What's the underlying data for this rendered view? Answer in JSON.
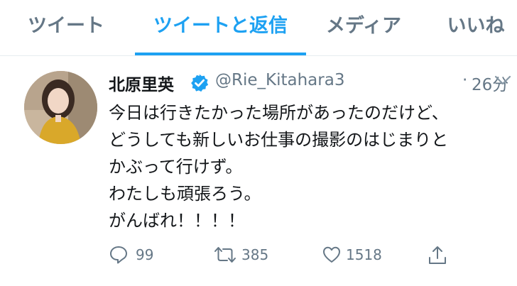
{
  "tabs": [
    {
      "label": "ツイート",
      "active": false
    },
    {
      "label": "ツイートと返信",
      "active": true
    },
    {
      "label": "メディア",
      "active": false
    },
    {
      "label": "いいね",
      "active": false
    }
  ],
  "tweet": {
    "author_name": "北原里英",
    "handle": "@Rie_Kitahara3",
    "separator": "·",
    "time": "26分",
    "lines": [
      "今日は行きたかった場所があったのだけど、",
      "どうしても新しいお仕事の撮影のはじまりと",
      "かぶって行けず。",
      "わたしも頑張ろう。",
      "がんばれ！！！！"
    ],
    "reply_count": "99",
    "retweet_count": "385",
    "like_count": "1518"
  },
  "colors": {
    "accent": "#1da1f2",
    "muted": "#657786",
    "text": "#14171a"
  },
  "icons": {
    "verified": "verified-badge-icon",
    "caret": "chevron-down-icon",
    "reply": "reply-icon",
    "retweet": "retweet-icon",
    "like": "heart-icon",
    "share": "share-icon"
  }
}
